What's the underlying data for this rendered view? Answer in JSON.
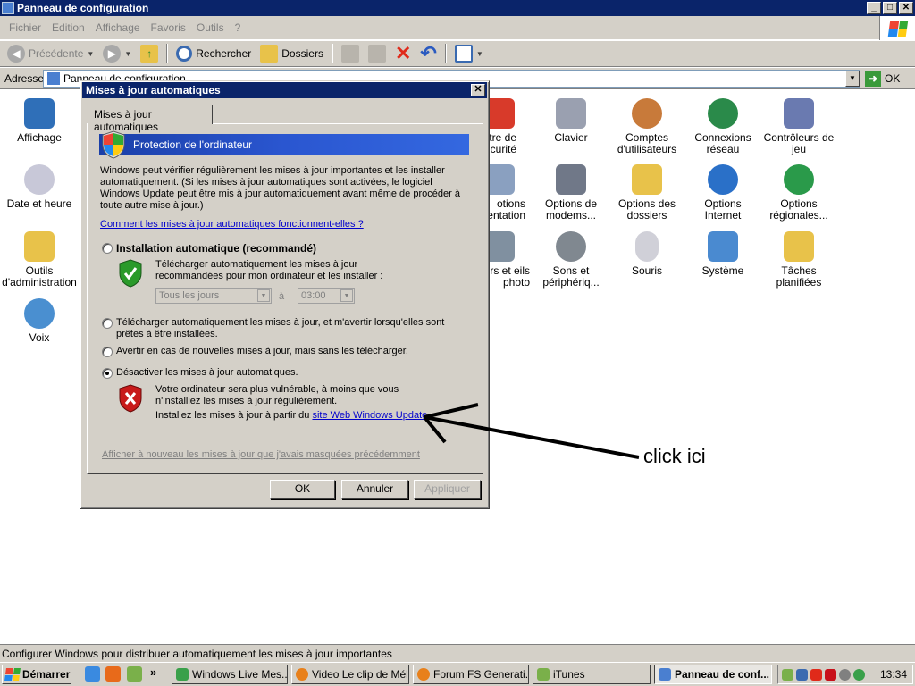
{
  "window": {
    "title": "Panneau de configuration",
    "buttons": [
      "_",
      "□",
      "✕"
    ]
  },
  "menu": [
    "Fichier",
    "Edition",
    "Affichage",
    "Favoris",
    "Outils",
    "?"
  ],
  "toolbar": {
    "back": "Précédente",
    "search": "Rechercher",
    "folders": "Dossiers"
  },
  "address": {
    "label": "Adresse",
    "value": "Panneau de configuration",
    "go": "OK"
  },
  "control_panel_items": [
    {
      "label": "Affichage",
      "color": "#2f6fb8"
    },
    {
      "label": "Date et heure",
      "color": "#c8c8d8"
    },
    {
      "label": "Outils d'administration",
      "color": "#e8c24a"
    },
    {
      "label": "Voix",
      "color": "#4a8fd0"
    },
    {
      "label": "tre de curité",
      "color": "#d83a2a"
    },
    {
      "label": "Clavier",
      "color": "#9aa0b0"
    },
    {
      "label": "Comptes d'utilisateurs",
      "color": "#c87a3a"
    },
    {
      "label": "Connexions réseau",
      "color": "#2a8a4a"
    },
    {
      "label": "Contrôleurs de jeu",
      "color": "#6a7ab0"
    },
    {
      "label": "otions entation",
      "color": "#8aa0c0"
    },
    {
      "label": "Options de modems...",
      "color": "#707888"
    },
    {
      "label": "Options des dossiers",
      "color": "#e8c24a"
    },
    {
      "label": "Options Internet",
      "color": "#2a70c8"
    },
    {
      "label": "Options régionales...",
      "color": "#2a9a4a"
    },
    {
      "label": "heurs et eils photo",
      "color": "#8090a0"
    },
    {
      "label": "Sons et périphériq...",
      "color": "#808890"
    },
    {
      "label": "Souris",
      "color": "#d0d0d8"
    },
    {
      "label": "Système",
      "color": "#4a8ad0"
    },
    {
      "label": "Tâches planifiées",
      "color": "#e8c24a"
    }
  ],
  "dialog": {
    "title": "Mises à jour automatiques",
    "close": "✕",
    "tab": "Mises à jour automatiques",
    "banner": "Protection de l'ordinateur",
    "intro": "Windows peut vérifier régulièrement les mises à jour importantes et les installer automatiquement. (Si les mises à jour automatiques sont activées, le logiciel Windows Update peut être mis à jour automatiquement avant même de procéder à toute autre mise à jour.)",
    "how_link": "Comment les mises à jour automatiques fonctionnent-elles ?",
    "opt1_label": "Installation automatique (recommandé)",
    "opt1_desc": "Télécharger automatiquement les mises à jour recommandées pour mon ordinateur et les installer :",
    "day_select": "Tous les jours",
    "at_label": "à",
    "time_select": "03:00",
    "opt2_label": "Télécharger automatiquement les mises à jour, et m'avertir lorsqu'elles sont prêtes à être installées.",
    "opt3_label": "Avertir en cas de nouvelles mises à jour, mais sans les télécharger.",
    "opt4_label": "Désactiver les mises à jour automatiques.",
    "warn_text": "Votre ordinateur sera plus vulnérable, à moins que vous n'installiez les mises à jour régulièrement.",
    "install_prefix": "Installez les mises à jour à partir du ",
    "install_link": "site Web Windows Update",
    "hidden_link": "Afficher à nouveau les mises à jour que j'avais masquées précédemment",
    "selected_option": 4,
    "ok": "OK",
    "cancel": "Annuler",
    "apply": "Appliquer"
  },
  "annotation": "click ici",
  "statusbar": "Configurer Windows pour distribuer automatiquement les mises à jour importantes",
  "taskbar": {
    "start": "Démarrer",
    "more": "»",
    "tasks": [
      {
        "label": "Windows Live Mes...",
        "active": false
      },
      {
        "label": "Video Le clip de Mél...",
        "active": false
      },
      {
        "label": "Forum FS Generati...",
        "active": false
      },
      {
        "label": "iTunes",
        "active": false
      },
      {
        "label": "Panneau de conf...",
        "active": true
      }
    ],
    "clock": "13:34"
  },
  "colors": {
    "titlebar": "#0a246a",
    "face": "#d4d0c8",
    "link": "#0000cc",
    "banner": "#2a56d0"
  }
}
